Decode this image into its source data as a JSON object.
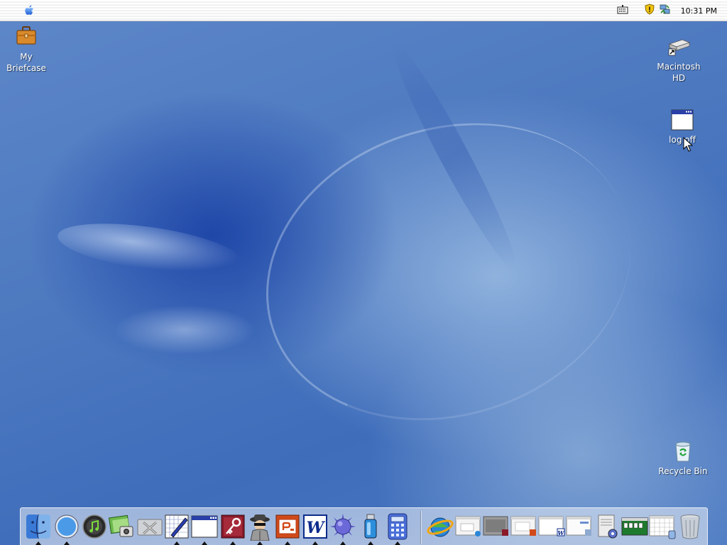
{
  "menubar": {
    "apple_icon": "apple-logo-icon",
    "tray_icons": [
      "keyboard-icon",
      "security-shield-icon",
      "network-icon"
    ],
    "clock": "10:31 PM"
  },
  "desktop": {
    "icons": [
      {
        "label": "My\nBriefcase",
        "icon": "briefcase-icon"
      },
      {
        "label": "Macintosh\nHD",
        "icon": "hard-drive-icon"
      },
      {
        "label": "log off",
        "icon": "window-icon"
      },
      {
        "label": "Recycle Bin",
        "icon": "recycle-bin-icon"
      }
    ]
  },
  "dock": {
    "left_items": [
      {
        "name": "finder-icon",
        "running": true
      },
      {
        "name": "safari-compass-icon",
        "running": true
      },
      {
        "name": "itunes-icon",
        "running": false
      },
      {
        "name": "iphoto-icon",
        "running": false
      },
      {
        "name": "system-tools-icon",
        "running": false
      },
      {
        "name": "text-editor-icon",
        "running": true
      },
      {
        "name": "window-icon",
        "running": true
      },
      {
        "name": "access-key-icon",
        "running": true
      },
      {
        "name": "spy-agent-icon",
        "running": true
      },
      {
        "name": "powerpoint-icon",
        "running": true
      },
      {
        "name": "word-icon",
        "running": true
      },
      {
        "name": "spiky-ball-icon",
        "running": true
      },
      {
        "name": "usb-drive-icon",
        "running": true
      },
      {
        "name": "calculator-icon",
        "running": true
      }
    ],
    "right_items": [
      {
        "name": "internet-explorer-icon"
      },
      {
        "name": "minimized-window-ie-icon"
      },
      {
        "name": "minimized-window-access-icon"
      },
      {
        "name": "minimized-window-powerpoint-icon"
      },
      {
        "name": "minimized-window-word-icon"
      },
      {
        "name": "minimized-window-generic-icon"
      },
      {
        "name": "minimized-settings-icon"
      },
      {
        "name": "minimized-solitaire-icon"
      },
      {
        "name": "minimized-calendar-icon"
      },
      {
        "name": "trash-icon"
      }
    ]
  }
}
